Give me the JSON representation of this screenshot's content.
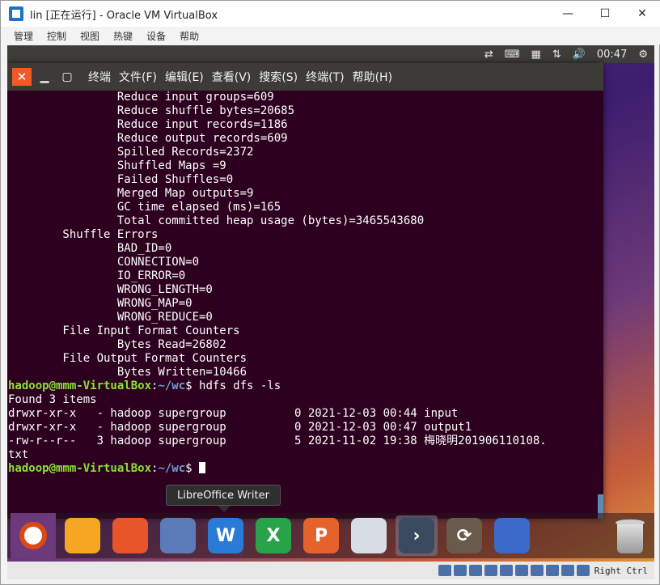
{
  "host": {
    "title": "lin [正在运行] - Oracle VM VirtualBox",
    "window_controls": {
      "minimize": "—",
      "maximize": "☐",
      "close": "✕"
    },
    "menu": [
      "管理",
      "控制",
      "视图",
      "热键",
      "设备",
      "帮助"
    ],
    "status": {
      "host_key": "Right Ctrl"
    }
  },
  "guest": {
    "topbar": {
      "time": "00:47",
      "icons": [
        "network-icon",
        "keyboard-icon",
        "drive-icon",
        "transfer-icon",
        "volume-icon",
        "settings-icon"
      ]
    }
  },
  "terminal": {
    "menu": [
      "终端",
      "文件(F)",
      "编辑(E)",
      "查看(V)",
      "搜索(S)",
      "终端(T)",
      "帮助(H)"
    ],
    "lines": [
      {
        "text": "                Reduce input groups=609"
      },
      {
        "text": "                Reduce shuffle bytes=20685"
      },
      {
        "text": "                Reduce input records=1186"
      },
      {
        "text": "                Reduce output records=609"
      },
      {
        "text": "                Spilled Records=2372"
      },
      {
        "text": "                Shuffled Maps =9"
      },
      {
        "text": "                Failed Shuffles=0"
      },
      {
        "text": "                Merged Map outputs=9"
      },
      {
        "text": "                GC time elapsed (ms)=165"
      },
      {
        "text": "                Total committed heap usage (bytes)=3465543680"
      },
      {
        "text": "        Shuffle Errors"
      },
      {
        "text": "                BAD_ID=0"
      },
      {
        "text": "                CONNECTION=0"
      },
      {
        "text": "                IO_ERROR=0"
      },
      {
        "text": "                WRONG_LENGTH=0"
      },
      {
        "text": "                WRONG_MAP=0"
      },
      {
        "text": "                WRONG_REDUCE=0"
      },
      {
        "text": "        File Input Format Counters"
      },
      {
        "text": "                Bytes Read=26802"
      },
      {
        "text": "        File Output Format Counters"
      },
      {
        "text": "                Bytes Written=10466"
      },
      {
        "prompt_user": "hadoop@mmm-VirtualBox",
        "prompt_path": "~/wc",
        "command": "hdfs dfs -ls"
      },
      {
        "text": "Found 3 items"
      },
      {
        "text": "drwxr-xr-x   - hadoop supergroup          0 2021-12-03 00:44 input"
      },
      {
        "text": "drwxr-xr-x   - hadoop supergroup          0 2021-12-03 00:47 output1"
      },
      {
        "text": "-rw-r--r--   3 hadoop supergroup          5 2021-11-02 19:38 梅晓明201906110108."
      },
      {
        "text": "txt"
      },
      {
        "prompt_user": "hadoop@mmm-VirtualBox",
        "prompt_path": "~/wc",
        "command": ""
      }
    ]
  },
  "tooltip": "LibreOffice Writer",
  "dock": [
    {
      "name": "files",
      "color": "#f6a623",
      "glyph": ""
    },
    {
      "name": "firefox",
      "color": "#e8552a",
      "glyph": ""
    },
    {
      "name": "chromium",
      "color": "#5b7bb8",
      "glyph": ""
    },
    {
      "name": "libreoffice-writer",
      "color": "#2a7ad8",
      "glyph": "W"
    },
    {
      "name": "libreoffice-calc",
      "color": "#29a34a",
      "glyph": "X"
    },
    {
      "name": "libreoffice-impress",
      "color": "#e5622a",
      "glyph": "P"
    },
    {
      "name": "software-center",
      "color": "#d8dde4",
      "glyph": ""
    },
    {
      "name": "terminal",
      "color": "#3a4a5e",
      "glyph": "›"
    },
    {
      "name": "software-updater",
      "color": "#6a5a4a",
      "glyph": "⟳"
    },
    {
      "name": "workspace-switcher",
      "color": "#3a6ac8",
      "glyph": ""
    }
  ]
}
